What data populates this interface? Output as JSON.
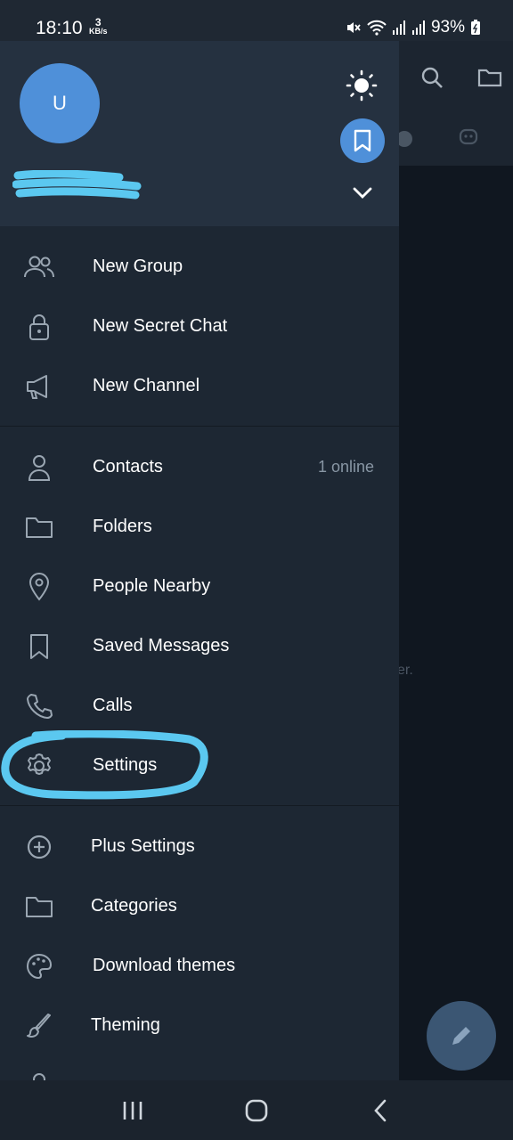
{
  "status_bar": {
    "time": "18:10",
    "net_speed_value": "3",
    "net_speed_unit": "KB/s",
    "battery": "93%"
  },
  "drawer": {
    "avatar_initial": "U",
    "accent_color": "#4f90d9",
    "groups": [
      [
        {
          "label": "New Group",
          "icon": "people-icon"
        },
        {
          "label": "New Secret Chat",
          "icon": "lock-icon"
        },
        {
          "label": "New Channel",
          "icon": "megaphone-icon"
        }
      ],
      [
        {
          "label": "Contacts",
          "icon": "person-icon",
          "extra": "1 online"
        },
        {
          "label": "Folders",
          "icon": "folder-icon"
        },
        {
          "label": "People Nearby",
          "icon": "location-pin-icon"
        },
        {
          "label": "Saved Messages",
          "icon": "bookmark-icon"
        },
        {
          "label": "Calls",
          "icon": "phone-icon"
        },
        {
          "label": "Settings",
          "icon": "gear-icon"
        }
      ],
      [
        {
          "label": "Plus Settings",
          "icon": "plus-circle-icon"
        },
        {
          "label": "Categories",
          "icon": "folder-icon"
        },
        {
          "label": "Download themes",
          "icon": "palette-icon"
        },
        {
          "label": "Theming",
          "icon": "brush-icon"
        }
      ]
    ]
  },
  "background": {
    "hint_fragment": "er."
  },
  "highlight_color": "#5bc8f0"
}
